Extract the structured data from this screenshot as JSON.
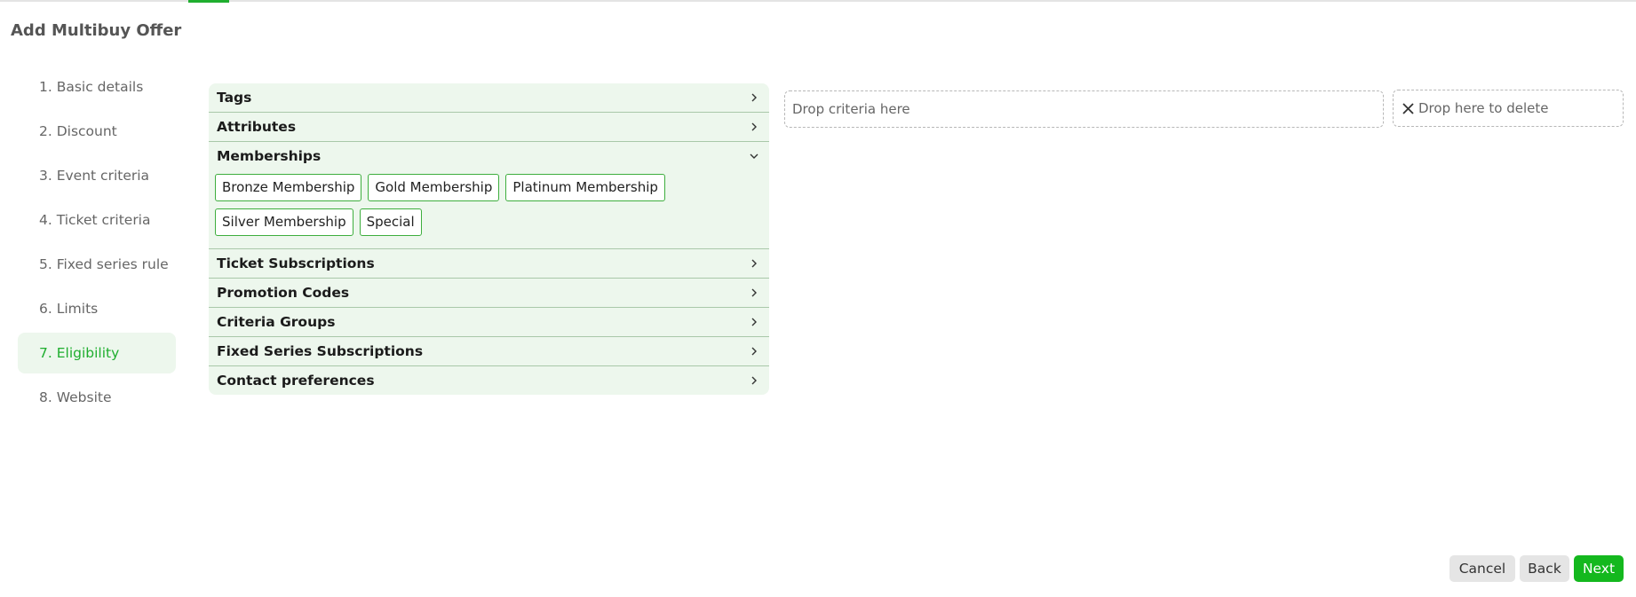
{
  "page": {
    "title": "Add Multibuy Offer"
  },
  "steps": [
    {
      "label": "1. Basic details"
    },
    {
      "label": "2. Discount"
    },
    {
      "label": "3. Event criteria"
    },
    {
      "label": "4. Ticket criteria"
    },
    {
      "label": "5. Fixed series rule"
    },
    {
      "label": "6. Limits"
    },
    {
      "label": "7. Eligibility"
    },
    {
      "label": "8. Website"
    }
  ],
  "active_step": "7. Eligibility",
  "accordion": {
    "sections": [
      {
        "title": "Tags",
        "expanded": false
      },
      {
        "title": "Attributes",
        "expanded": false
      },
      {
        "title": "Memberships",
        "expanded": true
      },
      {
        "title": "Ticket Subscriptions",
        "expanded": false
      },
      {
        "title": "Promotion Codes",
        "expanded": false
      },
      {
        "title": "Criteria Groups",
        "expanded": false
      },
      {
        "title": "Fixed Series Subscriptions",
        "expanded": false
      },
      {
        "title": "Contact preferences",
        "expanded": false
      }
    ],
    "memberships": [
      {
        "label": "Bronze Membership"
      },
      {
        "label": "Gold Membership"
      },
      {
        "label": "Platinum Membership"
      },
      {
        "label": "Silver Membership"
      },
      {
        "label": "Special"
      }
    ]
  },
  "drop_zone": {
    "text": "Drop criteria here"
  },
  "delete_zone": {
    "text": "Drop here to delete"
  },
  "buttons": {
    "cancel": "Cancel",
    "back": "Back",
    "next": "Next"
  },
  "colors": {
    "accent": "#1fae2f",
    "panel_bg": "#edf7ed",
    "next_button": "#14b81e"
  },
  "icons": {
    "expand": "chevron-right-icon",
    "collapse": "chevron-down-icon",
    "delete": "close-icon"
  }
}
